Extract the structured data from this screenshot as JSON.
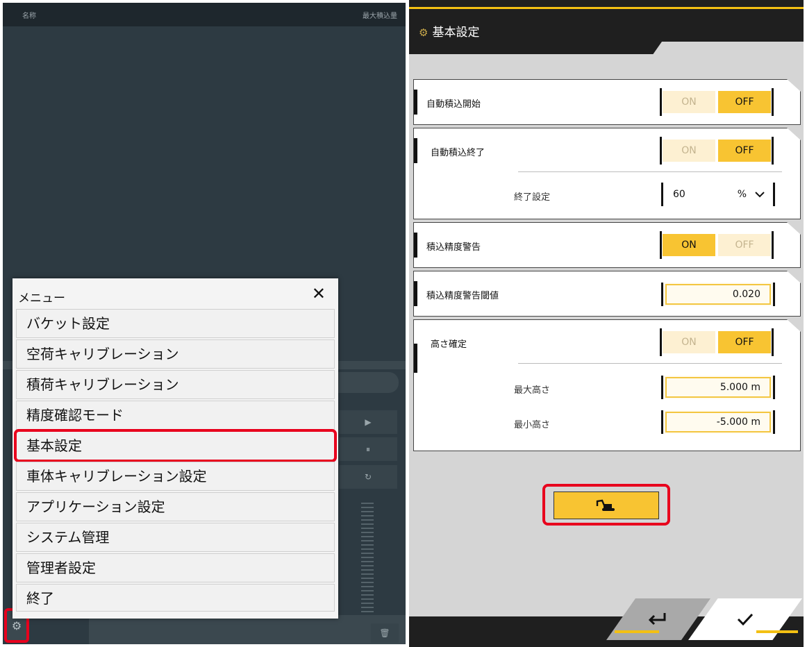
{
  "left_screen": {
    "header": {
      "col_name": "名称",
      "col_max": "最大積込量"
    },
    "menu": {
      "title": "メニュー",
      "close_symbol": "✕",
      "items": [
        {
          "label": "バケット設定"
        },
        {
          "label": "空荷キャリブレーション"
        },
        {
          "label": "積荷キャリブレーション"
        },
        {
          "label": "精度確認モード"
        },
        {
          "label": "基本設定",
          "highlighted": true
        },
        {
          "label": "車体キャリブレーション設定"
        },
        {
          "label": "アプリケーション設定"
        },
        {
          "label": "システム管理"
        },
        {
          "label": "管理者設定"
        },
        {
          "label": "終了"
        }
      ]
    },
    "highlight_color": "#e8001d"
  },
  "right_screen": {
    "title": "基本設定",
    "accent_color": "#f3c013",
    "toggle_on_label": "ON",
    "toggle_off_label": "OFF",
    "auto_load_start": {
      "label": "自動積込開始",
      "value": "OFF"
    },
    "auto_load_end": {
      "label": "自動積込終了",
      "value": "OFF",
      "end_setting": {
        "label": "終了設定",
        "value": "60",
        "unit": "%"
      }
    },
    "accuracy_warning": {
      "label": "積込精度警告",
      "value": "ON"
    },
    "accuracy_threshold": {
      "label": "積込精度警告閾値",
      "value": "0.020"
    },
    "height_confirm": {
      "label": "高さ確定",
      "value": "OFF",
      "max_height": {
        "label": "最大高さ",
        "value": "5.000 m"
      },
      "min_height": {
        "label": "最小高さ",
        "value": "-5.000 m"
      }
    },
    "icons": {
      "excavator": "excavator-icon",
      "back": "return-arrow-icon",
      "ok": "checkmark-icon"
    }
  }
}
